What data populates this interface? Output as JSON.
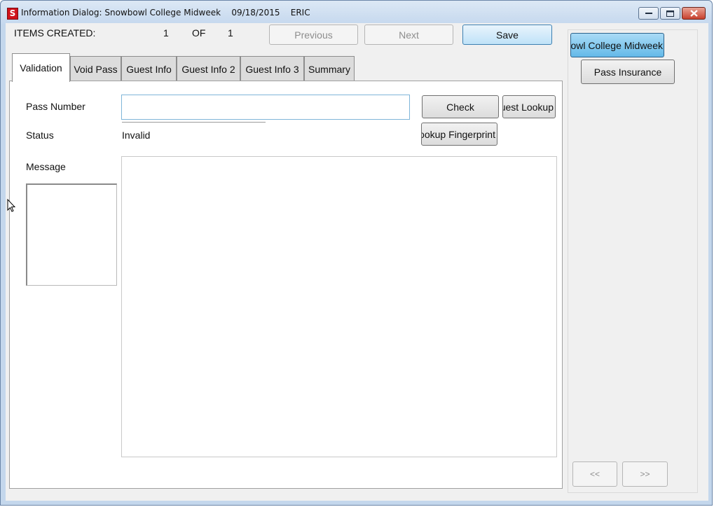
{
  "window": {
    "app_icon_letter": "S",
    "title": "Information Dialog: Snowbowl College Midweek    09/18/2015    ERIC"
  },
  "header": {
    "items_created_label": "ITEMS CREATED:",
    "current_item": "1",
    "of_label": "OF",
    "total_items": "1",
    "previous_label": "Previous",
    "next_label": "Next",
    "save_label": "Save"
  },
  "tabs": [
    {
      "label": "Validation",
      "active": true
    },
    {
      "label": "Void Pass",
      "active": false
    },
    {
      "label": "Guest Info",
      "active": false
    },
    {
      "label": "Guest Info 2",
      "active": false
    },
    {
      "label": "Guest Info 3",
      "active": false
    },
    {
      "label": "Summary",
      "active": false
    }
  ],
  "validation": {
    "pass_number_label": "Pass Number",
    "pass_number_value": "",
    "status_label": "Status",
    "status_value": "Invalid",
    "message_label": "Message",
    "message_value": "",
    "check_label": "Check",
    "guest_lookup_label": "Guest Lookup",
    "lookup_fingerprint_label": "Lookup Fingerprint"
  },
  "right_panel": {
    "product_button_label": "Snowbowl College Midweek",
    "pass_insurance_label": "Pass Insurance",
    "prev_page_label": "<<",
    "next_page_label": ">>"
  },
  "colors": {
    "title_bar": "#c5d8ee",
    "close_button": "#c8412e",
    "product_button": "#64b9e8",
    "save_button": "#bfe2f8"
  }
}
